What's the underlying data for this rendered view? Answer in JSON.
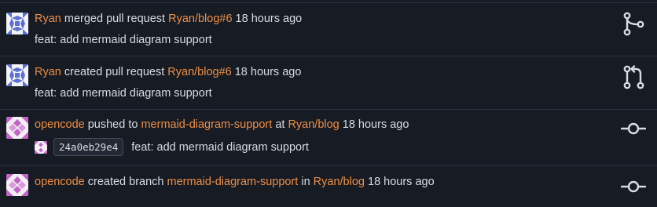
{
  "feed": {
    "items": [
      {
        "actor": "Ryan",
        "verb": "merged pull request",
        "target": "Ryan/blog#6",
        "time": "18 hours ago",
        "message": "feat: add mermaid diagram support",
        "icon": "merge-icon"
      },
      {
        "actor": "Ryan",
        "verb": "created pull request",
        "target": "Ryan/blog#6",
        "time": "18 hours ago",
        "message": "feat: add mermaid diagram support",
        "icon": "pull-request-icon"
      },
      {
        "actor": "opencode",
        "verb": "pushed to",
        "target": "mermaid-diagram-support",
        "connector": "at",
        "repo": "Ryan/blog",
        "time": "18 hours ago",
        "commit": {
          "sha": "24a0eb29e4",
          "message": "feat: add mermaid diagram support"
        },
        "icon": "commit-icon"
      },
      {
        "actor": "opencode",
        "verb": "created branch",
        "target": "mermaid-diagram-support",
        "connector": "in",
        "repo": "Ryan/blog",
        "time": "18 hours ago",
        "icon": "commit-icon"
      }
    ]
  },
  "colors": {
    "background": "#171b24",
    "link": "#ed8f44",
    "text": "#d7dbe2",
    "separator": "#2c3240",
    "avatar_ryan": "#5b6fd6",
    "avatar_opencode": "#c166c7"
  }
}
